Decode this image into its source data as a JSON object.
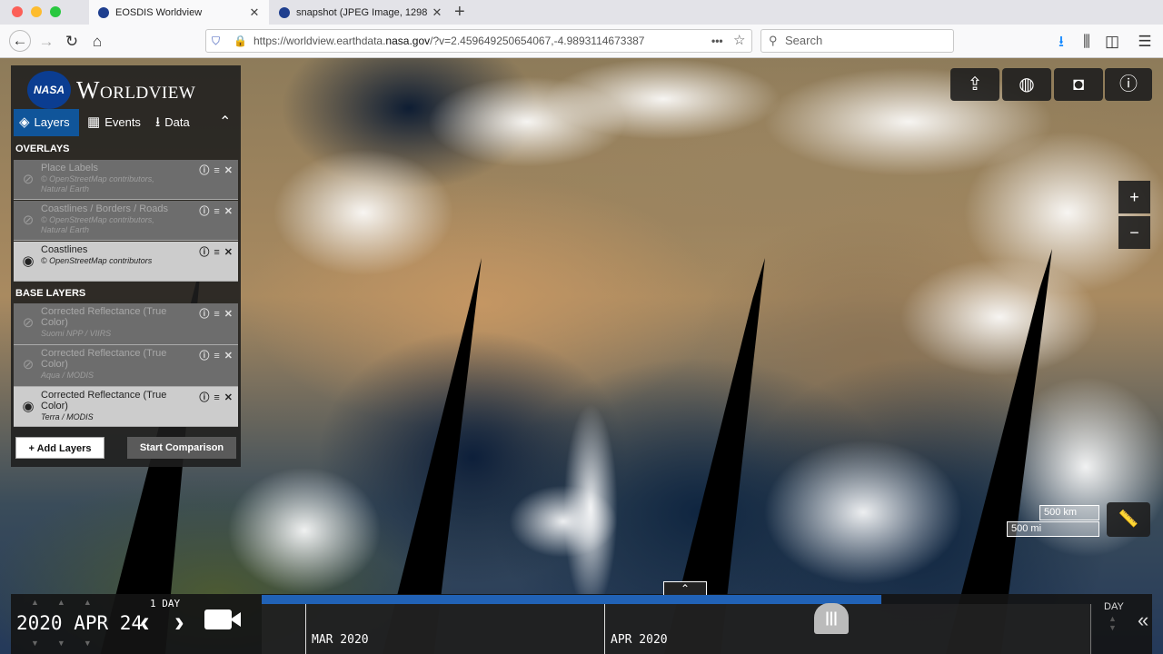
{
  "browser": {
    "tabs": [
      {
        "title": "EOSDIS Worldview",
        "active": true
      },
      {
        "title": "snapshot (JPEG Image, 1298 ×",
        "active": false
      }
    ],
    "url_prefix": "https://worldview.earthdata.",
    "url_domain": "nasa.gov",
    "url_rest": "/?v=2.459649250654067,-4.9893114673387",
    "search_placeholder": "Search"
  },
  "app": {
    "nasa": "NASA",
    "title": "Worldview",
    "tabs": {
      "layers": "Layers",
      "events": "Events",
      "data": "Data"
    },
    "overlays_title": "OVERLAYS",
    "base_layers_title": "BASE LAYERS",
    "overlays": [
      {
        "name": "Place Labels",
        "source": "© OpenStreetMap contributors, Natural Earth",
        "visible": false
      },
      {
        "name": "Coastlines / Borders / Roads",
        "source": "© OpenStreetMap contributors, Natural Earth",
        "visible": false
      },
      {
        "name": "Coastlines",
        "source": "© OpenStreetMap contributors",
        "visible": true
      }
    ],
    "base_layers": [
      {
        "name": "Corrected Reflectance (True Color)",
        "source": "Suomi NPP / VIIRS",
        "visible": false
      },
      {
        "name": "Corrected Reflectance (True Color)",
        "source": "Aqua / MODIS",
        "visible": false
      },
      {
        "name": "Corrected Reflectance (True Color)",
        "source": "Terra / MODIS",
        "visible": true
      }
    ],
    "add_layers": "+ Add Layers",
    "start_comparison": "Start Comparison",
    "scale_km": "500 km",
    "scale_mi": "500 mi",
    "zoom_in": "+",
    "zoom_out": "−"
  },
  "timeline": {
    "date": "2020 APR 24",
    "interval": "1 DAY",
    "zoom_level": "DAY",
    "labels": [
      "MAR 2020",
      "APR 2020"
    ]
  }
}
